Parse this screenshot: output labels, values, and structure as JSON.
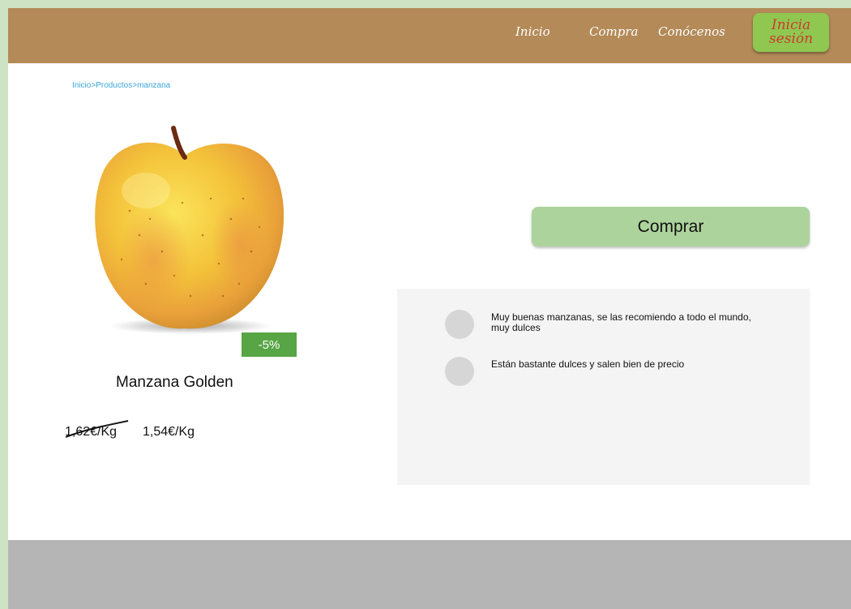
{
  "header": {
    "nav": [
      "Inicio",
      "Compra",
      "Conócenos"
    ],
    "login_line1": "Inicia",
    "login_line2": "sesión"
  },
  "breadcrumb": [
    "Inicio",
    ">",
    "Productos",
    ">",
    "manzana"
  ],
  "product": {
    "name": "Manzana Golden",
    "discount": "-5%",
    "old_price": "1,62€/Kg",
    "new_price": "1,54€/Kg"
  },
  "buy_label": "Comprar",
  "reviews": [
    "Muy buenas manzanas, se las recomiendo a todo el mundo, muy dulces",
    "Están bastante dulces y salen bien de precio"
  ],
  "colors": {
    "header": "#b38a58",
    "login_button": "#8fc751",
    "buy_button": "#add39d",
    "discount_badge": "#57a544",
    "footer": "#b5b5b5"
  }
}
